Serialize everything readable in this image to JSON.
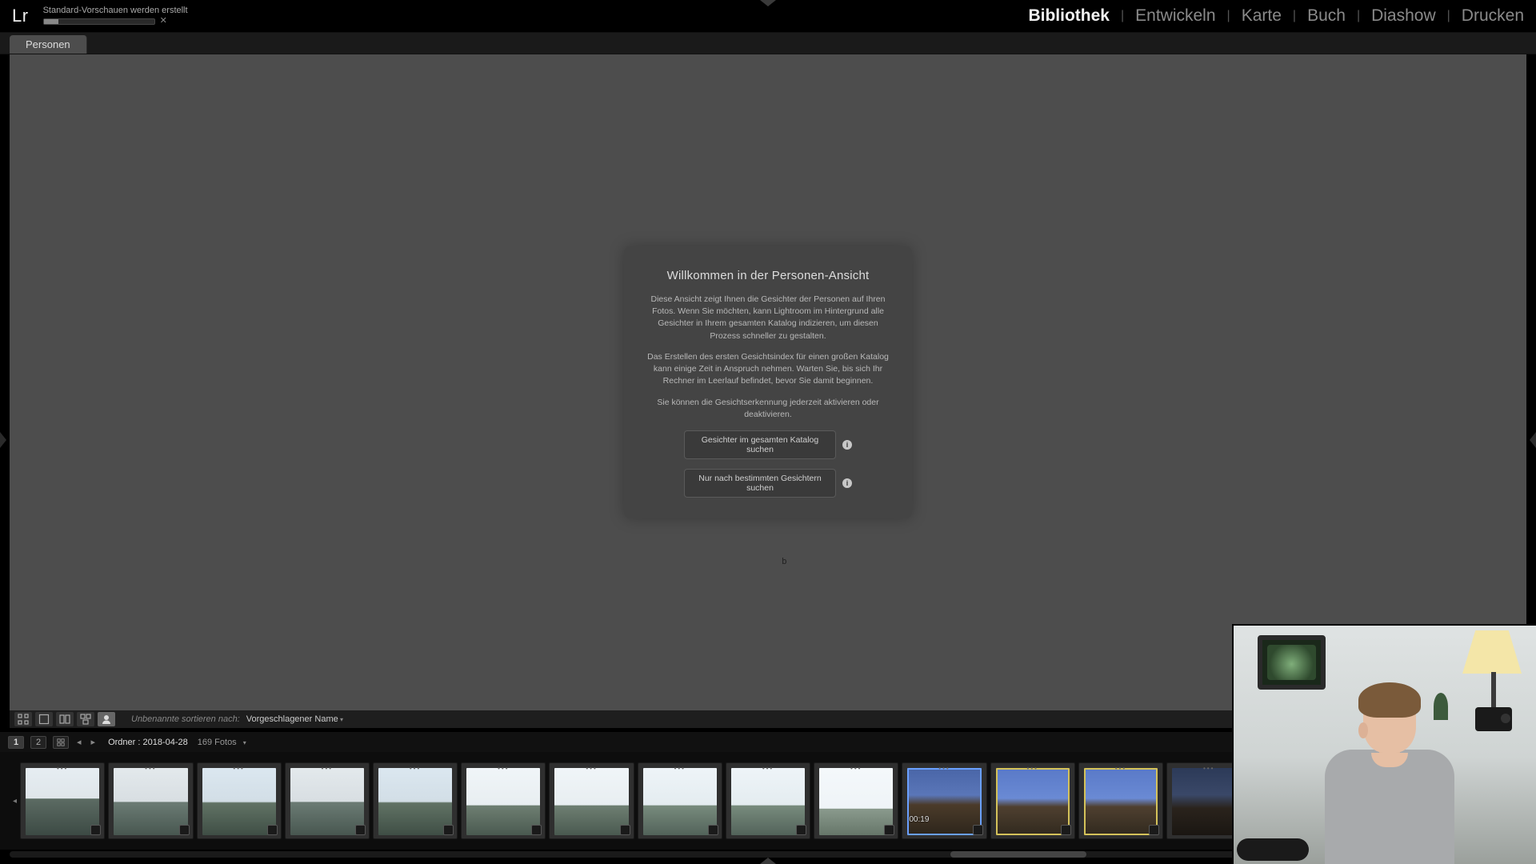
{
  "app": {
    "logo": "Lr"
  },
  "progress": {
    "label": "Standard-Vorschauen werden erstellt",
    "pct": 13
  },
  "modules": {
    "items": [
      "Bibliothek",
      "Entwickeln",
      "Karte",
      "Buch",
      "Diashow",
      "Drucken"
    ],
    "active": 0
  },
  "view_tabs": {
    "items": [
      "Personen"
    ],
    "active": 0
  },
  "welcome": {
    "title": "Willkommen in der Personen-Ansicht",
    "p1": "Diese Ansicht zeigt Ihnen die Gesichter der Personen auf Ihren Fotos. Wenn Sie möchten, kann Lightroom im Hintergrund alle Gesichter in Ihrem gesamten Katalog indizieren, um diesen Prozess schneller zu gestalten.",
    "p2": "Das Erstellen des ersten Gesichtsindex für einen großen Katalog kann einige Zeit in Anspruch nehmen. Warten Sie, bis sich Ihr Rechner im Leerlauf befindet, bevor Sie damit beginnen.",
    "p3": "Sie können die Gesichtserkennung jederzeit aktivieren oder deaktivieren.",
    "btn1": "Gesichter im gesamten Katalog suchen",
    "btn2": "Nur nach bestimmten Gesichtern suchen"
  },
  "sort": {
    "label": "Unbenannte sortieren nach:",
    "value": "Vorgeschlagener Name"
  },
  "filmstrip_header": {
    "source_label": "Ordner :",
    "source_value": "2018-04-28",
    "count_label": "169 Fotos"
  },
  "filmstrip": {
    "video_time": "00:19",
    "scroll": {
      "pos_pct": 62,
      "size_pct": 9
    }
  },
  "cursor_text": "b"
}
